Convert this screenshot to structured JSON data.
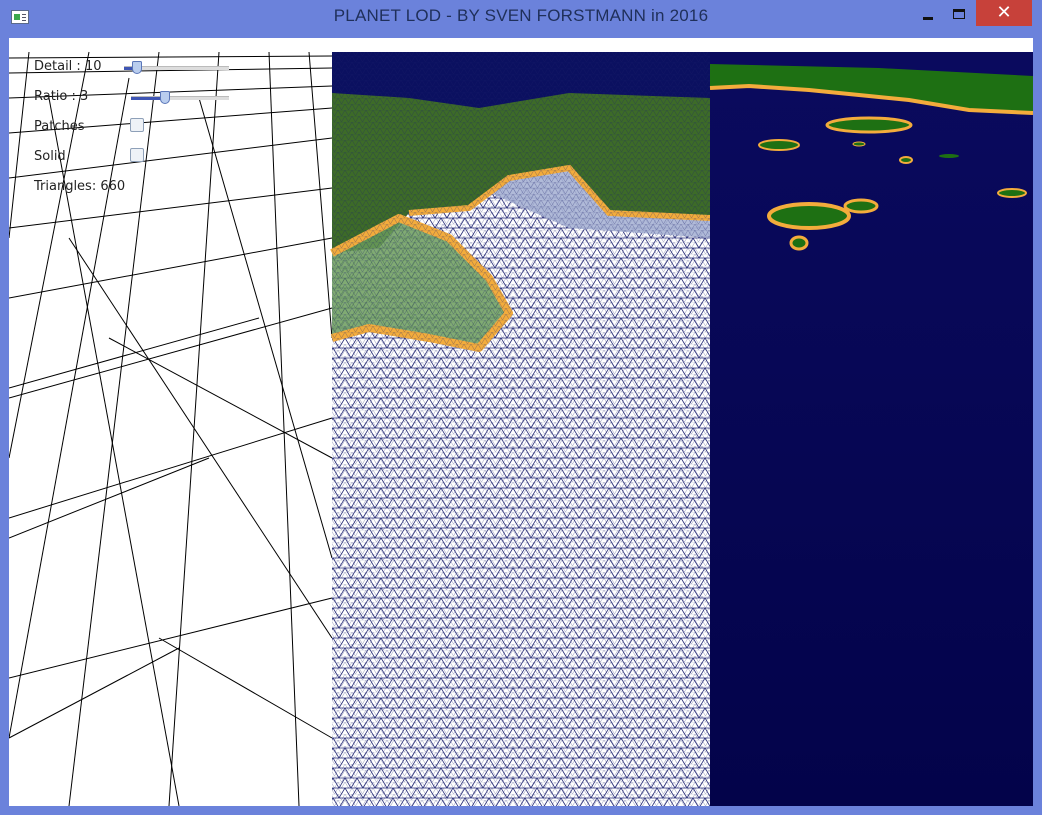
{
  "window": {
    "title": "PLANET LOD - BY SVEN FORSTMANN in 2016",
    "close_glyph": "✕"
  },
  "controls": {
    "detail": {
      "label": "Detail : 10",
      "fraction": 0.12
    },
    "ratio": {
      "label": "Ratio : 3",
      "fraction": 0.35
    },
    "patches": {
      "label": "Patches",
      "checked": false
    },
    "solid": {
      "label": "Solid",
      "checked": false
    },
    "triangles": {
      "label": "Triangles: 660"
    }
  },
  "colors": {
    "ocean": "#050558",
    "land": "#1e7013",
    "beach": "#f3ac3c",
    "accent": "#3e55b4",
    "close": "#c7413a"
  }
}
